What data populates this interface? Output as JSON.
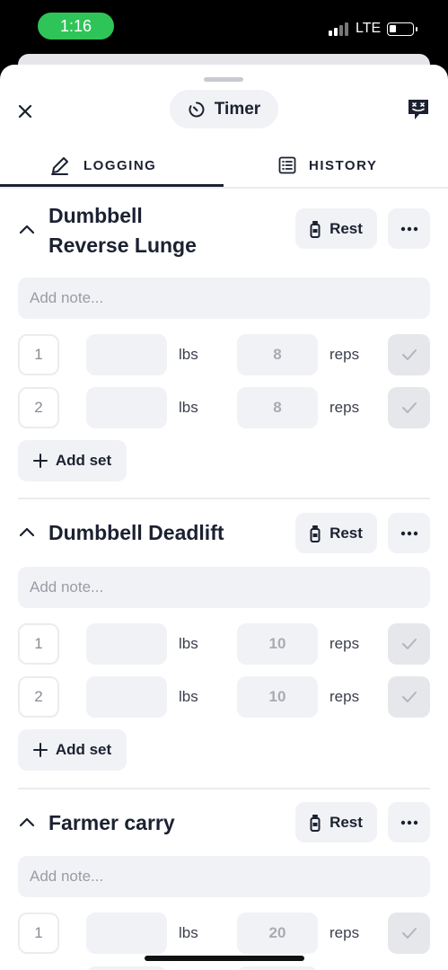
{
  "status_bar": {
    "time": "1:16",
    "network": "LTE"
  },
  "header": {
    "timer_label": "Timer",
    "close_icon": "close-icon",
    "chat_icon": "chat-bot-icon"
  },
  "tabs": [
    {
      "label": "LOGGING",
      "icon": "pencil-icon",
      "active": true
    },
    {
      "label": "HISTORY",
      "icon": "list-icon",
      "active": false
    }
  ],
  "common": {
    "rest_label": "Rest",
    "note_placeholder": "Add note...",
    "add_set_label": "Add set",
    "weight_unit": "lbs",
    "reps_unit": "reps"
  },
  "exercises": [
    {
      "title_lines": [
        "Dumbbell",
        "Reverse Lunge"
      ],
      "sets": [
        {
          "number": "1",
          "reps": "8"
        },
        {
          "number": "2",
          "reps": "8"
        }
      ]
    },
    {
      "title_lines": [
        "Dumbbell Deadlift"
      ],
      "sets": [
        {
          "number": "1",
          "reps": "10"
        },
        {
          "number": "2",
          "reps": "10"
        }
      ]
    },
    {
      "title_lines": [
        "Farmer carry"
      ],
      "sets": [
        {
          "number": "1",
          "reps": "20"
        }
      ]
    }
  ]
}
